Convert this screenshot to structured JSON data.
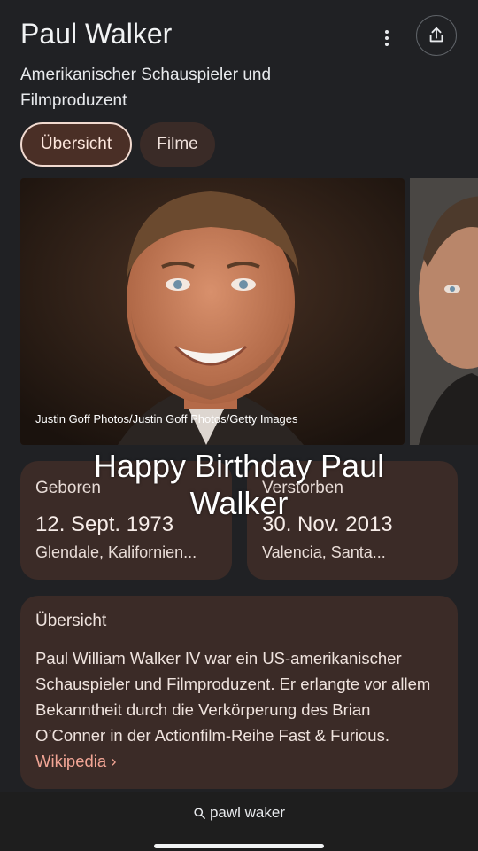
{
  "header": {
    "title": "Paul Walker",
    "subtitle": "Amerikanischer Schauspieler und Filmproduzent"
  },
  "tabs": [
    {
      "label": "Übersicht",
      "active": true
    },
    {
      "label": "Filme",
      "active": false
    }
  ],
  "photo": {
    "credit": "Justin Goff Photos/Justin Goff Photos/Getty Images"
  },
  "overlay_text": "Happy Birthday Paul Walker",
  "facts": {
    "born": {
      "label": "Geboren",
      "date": "12. Sept. 1973",
      "place": "Glendale, Kalifornien..."
    },
    "died": {
      "label": "Verstorben",
      "date": "30. Nov. 2013",
      "place": "Valencia, Santa..."
    }
  },
  "overview": {
    "title": "Übersicht",
    "text": "Paul William Walker IV war ein US-amerikanischer Schauspieler und Filmproduzent. Er erlangte vor allem Bekanntheit durch die Verkörperung des Brian O’Conner in der Actionfilm-Reihe Fast & Furious.",
    "link_label": "Wikipedia ›"
  },
  "bottom_bar": {
    "query": "pawl waker"
  },
  "icons": {
    "more": "more-vert-icon",
    "share": "share-icon",
    "search": "search-icon"
  },
  "colors": {
    "background": "#202124",
    "card": "#3b2b27",
    "chip_active": "#4a2f26",
    "link": "#f2a595"
  }
}
